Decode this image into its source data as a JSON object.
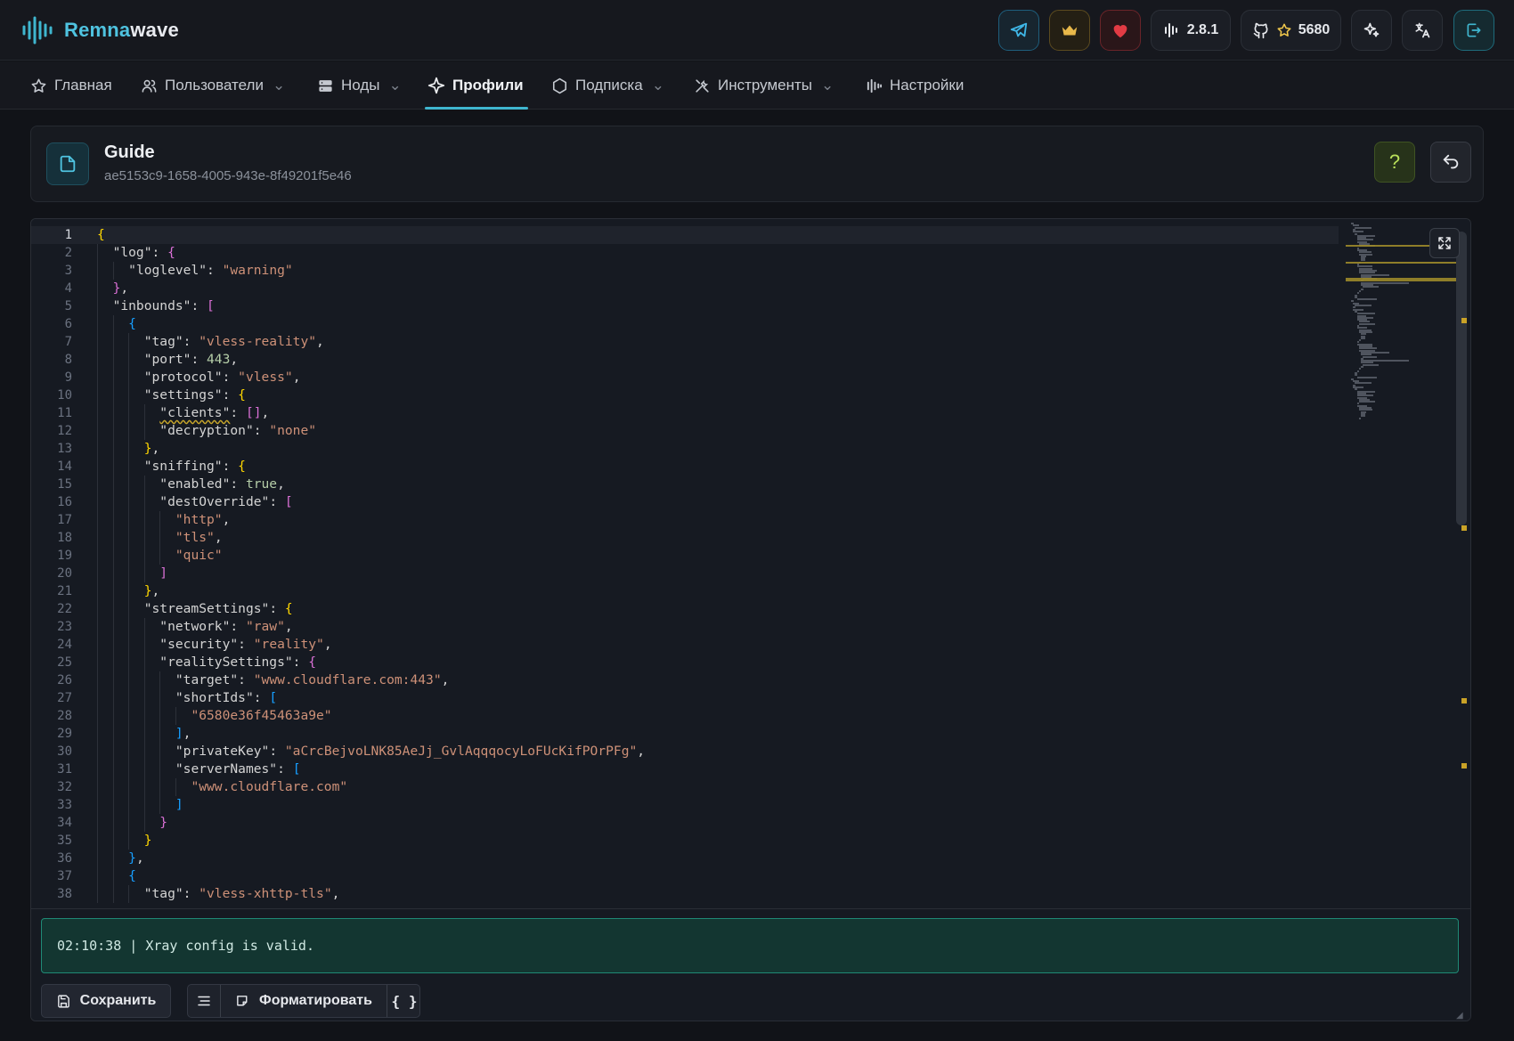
{
  "brand": {
    "name_a": "Remna",
    "name_b": "wave"
  },
  "header": {
    "version": "2.8.1",
    "github_stars": "5680",
    "icons": [
      "telegram-icon",
      "crown-icon",
      "heart-icon",
      "activity-icon",
      "github-icon",
      "star-icon",
      "sparkles-icon",
      "translate-icon",
      "logout-icon"
    ]
  },
  "nav": {
    "items": [
      {
        "label": "Главная",
        "icon": "star-icon",
        "dropdown": false
      },
      {
        "label": "Пользователи",
        "icon": "users-icon",
        "dropdown": true
      },
      {
        "label": "Ноды",
        "icon": "server-icon",
        "dropdown": true
      },
      {
        "label": "Профили",
        "icon": "sparkle-icon",
        "dropdown": false,
        "active": true
      },
      {
        "label": "Подписка",
        "icon": "hexagon-icon",
        "dropdown": true
      },
      {
        "label": "Инструменты",
        "icon": "tools-icon",
        "dropdown": true
      },
      {
        "label": "Настройки",
        "icon": "sliders-icon",
        "dropdown": false
      }
    ]
  },
  "profile": {
    "title": "Guide",
    "uuid": "ae5153c9-1658-4005-943e-8f49201f5e46",
    "help_label": "?"
  },
  "editor": {
    "current_line": 1,
    "lines": [
      "{",
      "  \"log\": {",
      "    \"loglevel\": \"warning\"",
      "  },",
      "  \"inbounds\": [",
      "    {",
      "      \"tag\": \"vless-reality\",",
      "      \"port\": 443,",
      "      \"protocol\": \"vless\",",
      "      \"settings\": {",
      "        \"clients\": [],",
      "        \"decryption\": \"none\"",
      "      },",
      "      \"sniffing\": {",
      "        \"enabled\": true,",
      "        \"destOverride\": [",
      "          \"http\",",
      "          \"tls\",",
      "          \"quic\"",
      "        ]",
      "      },",
      "      \"streamSettings\": {",
      "        \"network\": \"raw\",",
      "        \"security\": \"reality\",",
      "        \"realitySettings\": {",
      "          \"target\": \"www.cloudflare.com:443\",",
      "          \"shortIds\": [",
      "            \"6580e36f45463a9e\"",
      "          ],",
      "          \"privateKey\": \"aCrcBejvoLNK85AeJj_GvlAqqqocyLoFUcKifPOrPFg\",",
      "          \"serverNames\": [",
      "            \"www.cloudflare.com\"",
      "          ]",
      "        }",
      "      }",
      "    },",
      "    {",
      "      \"tag\": \"vless-xhttp-tls\","
    ]
  },
  "status": {
    "message": "02:10:38 | Xray config is valid."
  },
  "actions": {
    "save_label": "Сохранить",
    "format_label": "Форматировать",
    "braces_label": "{ }"
  },
  "colors": {
    "accent": "#3fb6cf",
    "status_border": "#1f8a76",
    "string": "#ce9178",
    "number": "#b5cea8",
    "bracket_1": "#ffd700",
    "bracket_2": "#da70d6",
    "bracket_3": "#179fff"
  }
}
